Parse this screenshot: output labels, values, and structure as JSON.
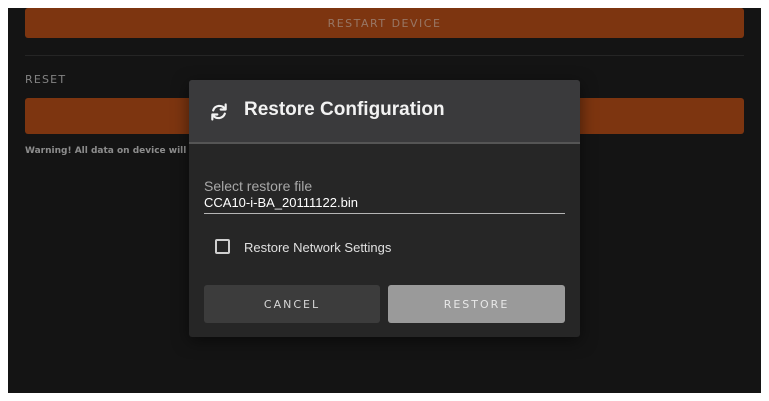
{
  "background": {
    "restart_button_label": "RESTART DEVICE",
    "reset_section_label": "RESET",
    "reset_button_label": "",
    "warning_text": "Warning! All data on device will be"
  },
  "dialog": {
    "title": "Restore Configuration",
    "icon": "refresh-icon",
    "file_field": {
      "label": "Select restore file",
      "value": "CCA10-i-BA_20111122.bin"
    },
    "checkbox": {
      "label": "Restore Network Settings",
      "checked": false
    },
    "cancel_label": "CANCEL",
    "restore_label": "RESTORE"
  },
  "colors": {
    "accent": "#c0521a",
    "background": "#202020",
    "dialog_header": "#3a3a3c",
    "dialog_body": "#262626"
  }
}
